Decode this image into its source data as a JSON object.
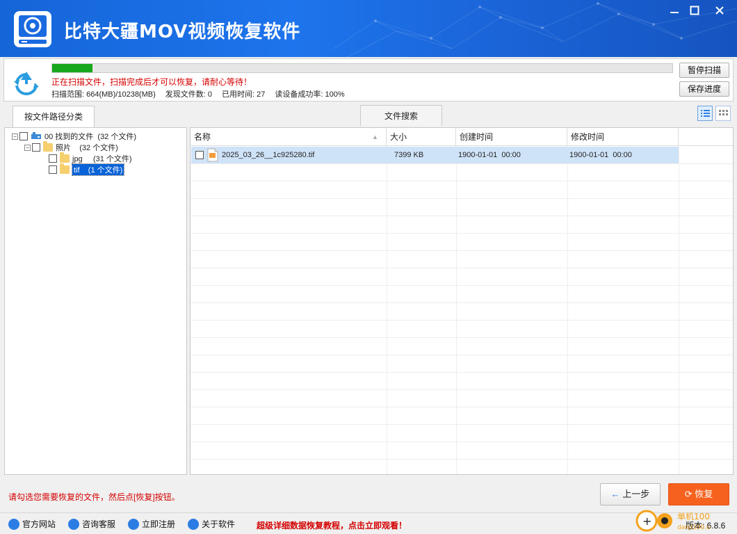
{
  "app": {
    "title": "比特大疆MOV视频恢复软件"
  },
  "scan": {
    "progress": 0.065,
    "message": "正在扫描文件，扫描完成后才可以恢复，请耐心等待！",
    "range": "扫描范围: 664(MB)/10238(MB)",
    "found": "发现文件数: 0",
    "elapsed": "已用时间: 27",
    "read_rate": "读设备成功率: 100%",
    "pause_label": "暂停扫描",
    "save_label": "保存进度"
  },
  "tabs": [
    {
      "label": "按文件路径分类"
    },
    {
      "label": "文件搜索"
    }
  ],
  "tree": {
    "root": "00 找到的文件  (32 个文件)",
    "photos": "照片    (32 个文件)",
    "jpg": "jpg     (31 个文件)",
    "tif": "tif    (1 个文件)"
  },
  "list": {
    "columns": [
      "名称",
      "大小",
      "创建时间",
      "修改时间"
    ],
    "rows": [
      {
        "name": "2025_03_26__1c925280.tif",
        "size": "7399 KB",
        "created": "1900-01-01  00:00",
        "modified": "1900-01-01  00:00"
      }
    ]
  },
  "footer": {
    "hint": "请勾选您需要恢复的文件，然后点[恢复]按钮。",
    "back_label": "上一步",
    "recover_label": "恢复"
  },
  "statusbar": {
    "links": [
      "官方网站",
      "咨询客服",
      "立即注册",
      "关于软件"
    ],
    "promo": "超级详细数据恢复教程，点击立即观看！",
    "version": "版本: 6.8.6"
  },
  "watermark": {
    "text": "单机100网",
    "sub": "danji100.com"
  },
  "colors": {
    "titlebar": "#1a6ae0",
    "accent": "#f6621e",
    "progress": "#18a81d",
    "warning": "#d40000"
  }
}
